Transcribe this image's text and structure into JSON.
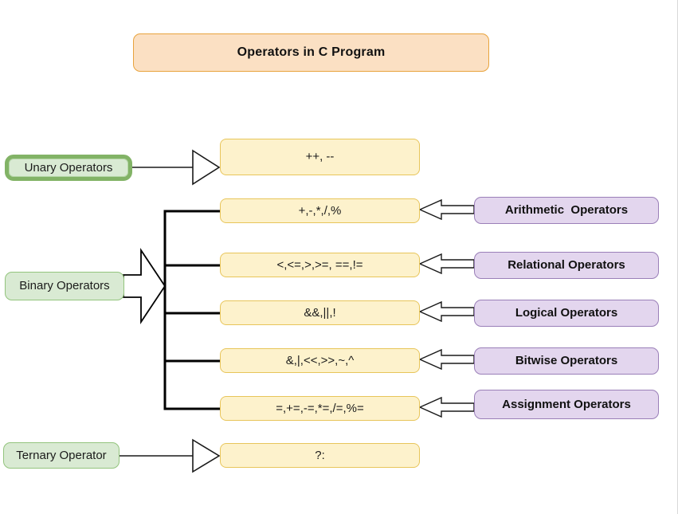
{
  "diagram": {
    "title": "Operators in C Program",
    "background_color": "#ffffff",
    "palette": {
      "title_fill": "#fbe0c3",
      "title_border": "#e8a33d",
      "category_fill": "#d9ead3",
      "category_border": "#93c47d",
      "operator_fill": "#fdf2cc",
      "operator_border": "#e8c55a",
      "label_fill": "#e3d6ee",
      "label_border": "#9a7fb8",
      "connector": "#000000"
    },
    "categories": [
      {
        "id": "unary",
        "label": "Unary Operators"
      },
      {
        "id": "binary",
        "label": "Binary Operators"
      },
      {
        "id": "ternary",
        "label": "Ternary Operator"
      }
    ],
    "operator_boxes": [
      {
        "id": "unary-ops",
        "symbols": "++, --"
      },
      {
        "id": "arithmetic-ops",
        "symbols": "+,-,*,/,%"
      },
      {
        "id": "relational-ops",
        "symbols": "<,<=,>,>=, ==,!="
      },
      {
        "id": "logical-ops",
        "symbols": "&&,||,!"
      },
      {
        "id": "bitwise-ops",
        "symbols": "&,|,<<,>>,~,^"
      },
      {
        "id": "assignment-ops",
        "symbols": "=,+=,-=,*=,/=,%="
      },
      {
        "id": "ternary-ops",
        "symbols": "?:"
      }
    ],
    "operator_labels": [
      {
        "id": "arithmetic-label",
        "label": "Arithmetic  Operators"
      },
      {
        "id": "relational-label",
        "label": "Relational Operators"
      },
      {
        "id": "logical-label",
        "label": "Logical Operators"
      },
      {
        "id": "bitwise-label",
        "label": "Bitwise Operators"
      },
      {
        "id": "assignment-label",
        "label": "Assignment Operators"
      }
    ]
  }
}
